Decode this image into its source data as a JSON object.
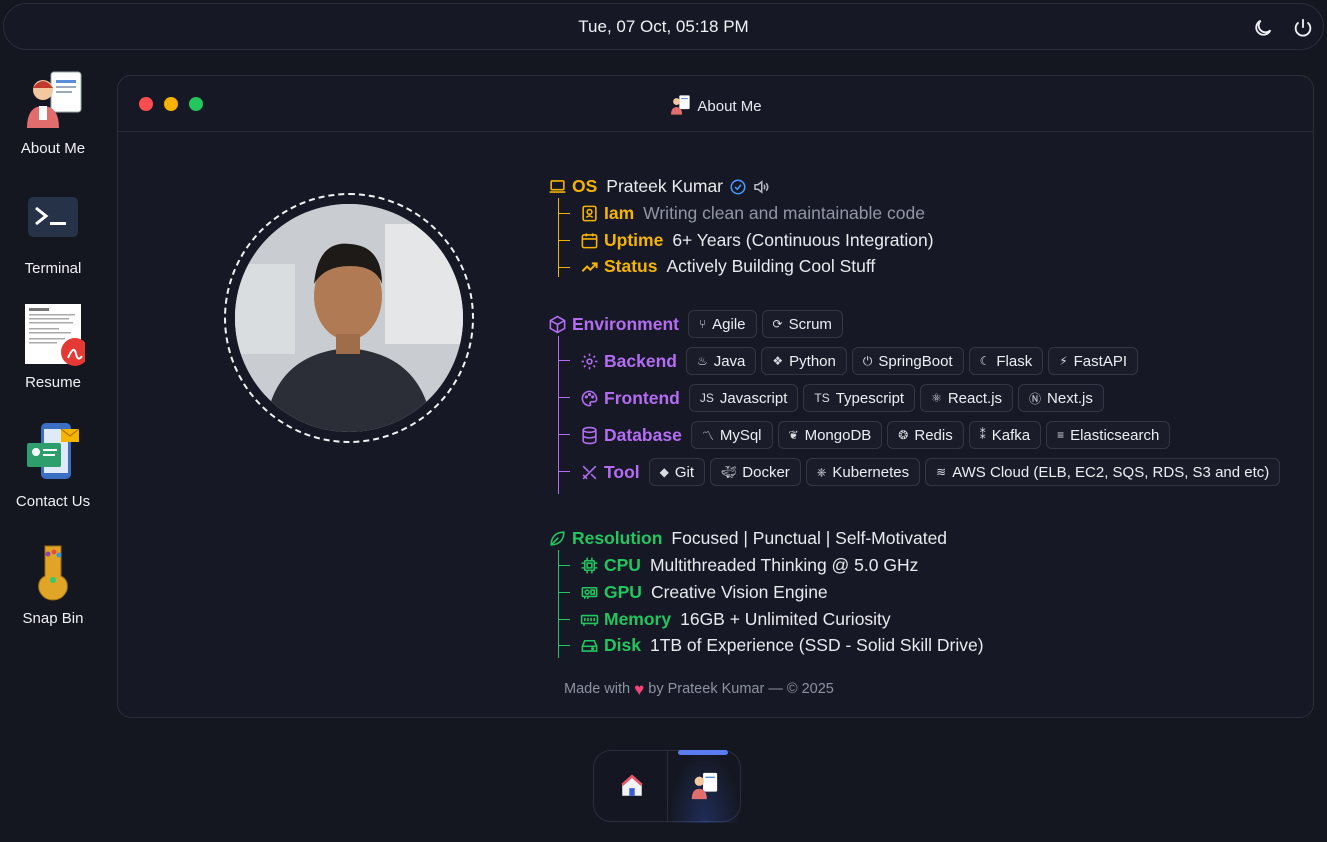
{
  "topbar": {
    "datetime": "Tue, 07 Oct, 05:18 PM"
  },
  "desktop": {
    "about": "About Me",
    "terminal": "Terminal",
    "resume": "Resume",
    "contact": "Contact Us",
    "snapbin": "Snap Bin"
  },
  "window": {
    "title": "About Me"
  },
  "os": {
    "key": "OS",
    "name": "Prateek Kumar",
    "iam_key": "Iam",
    "iam_val": "Writing clean and maintainable code",
    "uptime_key": "Uptime",
    "uptime_val": "6+ Years (Continuous Integration)",
    "status_key": "Status",
    "status_val": "Actively Building Cool Stuff"
  },
  "environment": {
    "key": "Environment",
    "chips": [
      "Agile",
      "Scrum"
    ],
    "backend_key": "Backend",
    "backend": [
      "Java",
      "Python",
      "SpringBoot",
      "Flask",
      "FastAPI"
    ],
    "frontend_key": "Frontend",
    "frontend": [
      "Javascript",
      "Typescript",
      "React.js",
      "Next.js"
    ],
    "database_key": "Database",
    "database": [
      "MySql",
      "MongoDB",
      "Redis",
      "Kafka",
      "Elasticsearch"
    ],
    "tool_key": "Tool",
    "tool": [
      "Git",
      "Docker",
      "Kubernetes",
      "AWS Cloud (ELB, EC2, SQS, RDS, S3 and etc)"
    ]
  },
  "resolution": {
    "key": "Resolution",
    "val": "Focused | Punctual | Self-Motivated",
    "cpu_key": "CPU",
    "cpu_val": "Multithreaded Thinking @ 5.0 GHz",
    "gpu_key": "GPU",
    "gpu_val": "Creative Vision Engine",
    "mem_key": "Memory",
    "mem_val": "16GB + Unlimited Curiosity",
    "disk_key": "Disk",
    "disk_val": "1TB of Experience (SSD - Solid Skill Drive)"
  },
  "footer": {
    "made": "Made with",
    "by": "by Prateek Kumar — © 2025"
  },
  "colors": {
    "os": "#f5b400",
    "environment": "#b36cf2",
    "resolution": "#22c55e",
    "background": "#141620"
  }
}
